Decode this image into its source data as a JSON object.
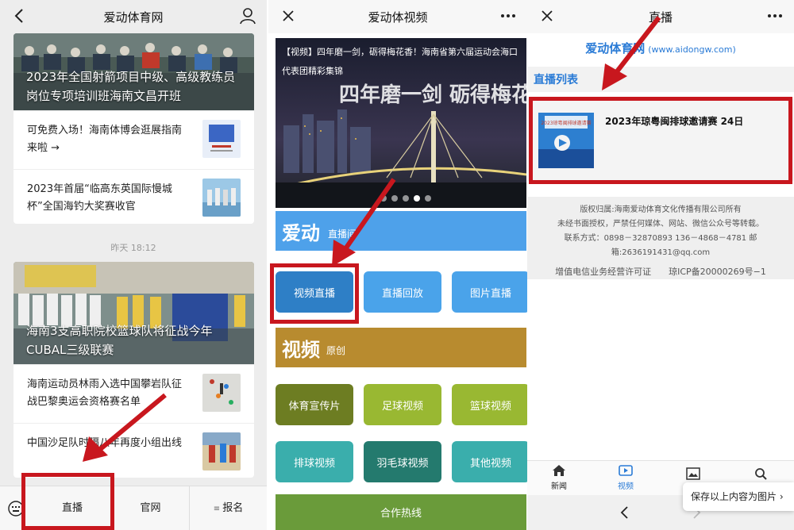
{
  "panel1": {
    "title": "爱动体育网",
    "card1": {
      "caption": "2023年全国射箭项目中级、高级教练员岗位专项培训班海南文昌开班",
      "items": [
        {
          "text": "可免费入场！海南体博会逛展指南来啦 →"
        },
        {
          "text": "2023年首届“临高东英国际慢城杯”全国海钓大奖赛收官"
        }
      ]
    },
    "time": "昨天 18:12",
    "card2": {
      "caption": "海南3支高职院校篮球队将征战今年CUBAL三级联赛",
      "items": [
        {
          "text": "海南运动员林雨入选中国攀岩队征战巴黎奥运会资格赛名单"
        },
        {
          "text": "中国沙足队时隔八年再度小组出线"
        }
      ]
    },
    "tabs": {
      "live": "直播",
      "official": "官网",
      "register": "报名"
    }
  },
  "panel2": {
    "title": "爱动体视频",
    "banner_caption": "【视频】四年磨一剑，砺得梅花香！海南省第六届运动会海口代表团精彩集锦",
    "banner_art": "四年磨一剑 砺得梅花香",
    "section1": {
      "big": "爱动",
      "small": "直播间"
    },
    "row1": [
      "视频直播",
      "直播回放",
      "图片直播"
    ],
    "section2": {
      "big": "视频",
      "small": "原创"
    },
    "row2": [
      "体育宣传片",
      "足球视频",
      "篮球视频"
    ],
    "row3": [
      "排球视频",
      "羽毛球视频",
      "其他视频"
    ],
    "bottom": "合作热线"
  },
  "panel3": {
    "title": "直播",
    "logo": "爱动体育网",
    "logo_url": "(www.aidongw.com)",
    "list_title": "直播列表",
    "live_title": "2023年琼粤闽排球邀请赛 24日",
    "live_thumb_text": "2023琼粤闽排球邀请赛",
    "footer": [
      "版权归属:海南爱动体育文化传播有限公司所有",
      "未经书面授权，严禁任何媒体、网站、微信公众号等转载。",
      "联系方式：0898－32870893 136－4868－4781 邮箱:2636191431@qq.com",
      "增值电信业务经营许可证　　琼ICP备20000269号−1"
    ],
    "tabs": {
      "news": "新闻",
      "video": "视频"
    },
    "toast": "保存以上内容为图片 ›"
  },
  "colors": {
    "accent_red": "#c8171e",
    "blue": "#3b8fd9",
    "brand_blue": "#2a7bd6"
  }
}
